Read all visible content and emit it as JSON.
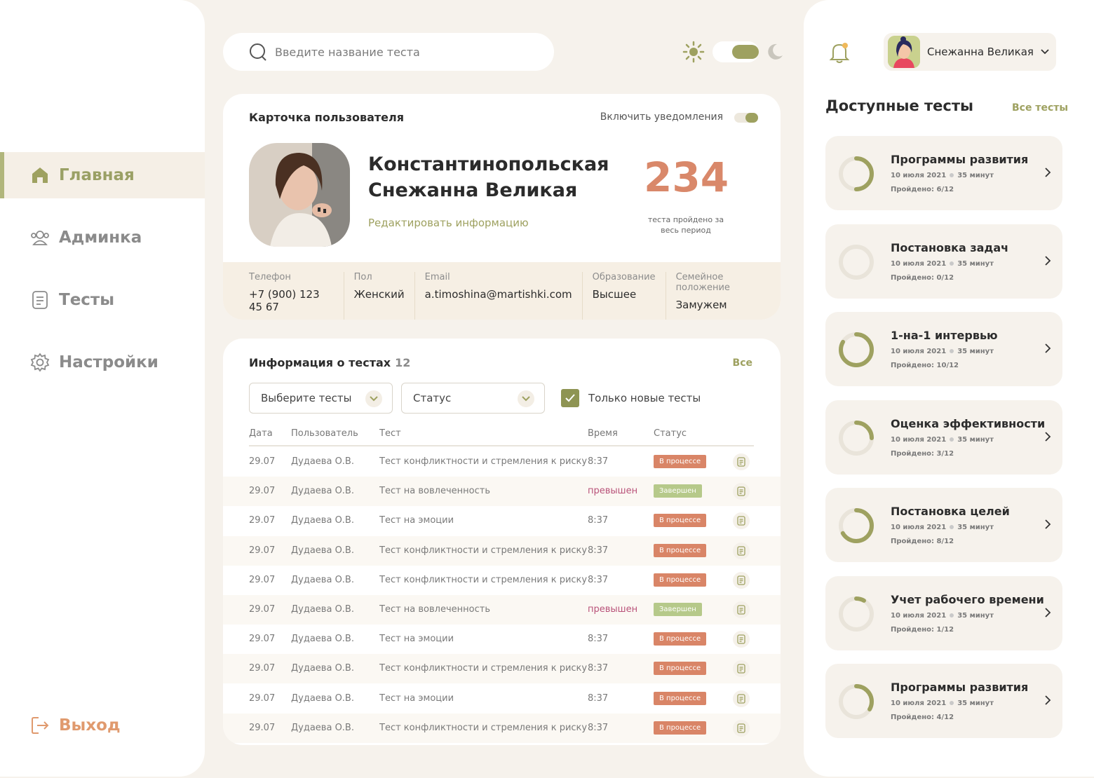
{
  "sidebar": {
    "items": [
      {
        "label": "Главная",
        "icon": "home-icon",
        "active": true
      },
      {
        "label": "Админка",
        "icon": "users-icon",
        "active": false
      },
      {
        "label": "Тесты",
        "icon": "document-icon",
        "active": false
      },
      {
        "label": "Настройки",
        "icon": "gear-icon",
        "active": false
      }
    ],
    "logout": "Выход"
  },
  "search": {
    "placeholder": "Введите название теста"
  },
  "profile": {
    "name": "Снежанна Великая"
  },
  "user_card": {
    "title": "Карточка пользователя",
    "notifications_label": "Включить уведомления",
    "name_line1": "Константинопольская",
    "name_line2": "Снежанна Великая",
    "edit_link": "Редактировать информацию",
    "tests_passed": "234",
    "tests_passed_label_1": "теста пройдено за",
    "tests_passed_label_2": "весь период",
    "info": [
      {
        "label": "Телефон",
        "value": "+7 (900) 123 45 67"
      },
      {
        "label": "Пол",
        "value": "Женский"
      },
      {
        "label": "Email",
        "value": "a.timoshina@martishki.com"
      },
      {
        "label": "Образование",
        "value": "Высшее"
      },
      {
        "label": "Семейное положение",
        "value": "Замужем"
      }
    ]
  },
  "tests_info": {
    "title": "Информация о тестах",
    "count": "12",
    "all_link": "Все",
    "select_tests": "Выберите тесты",
    "select_status": "Статус",
    "only_new_label": "Только новые тесты",
    "columns": [
      "Дата",
      "Пользователь",
      "Тест",
      "Время",
      "Статус"
    ],
    "rows": [
      {
        "date": "29.07",
        "user": "Дудаева О.В.",
        "test": "Тест конфликтности и стремления к риску",
        "time": "8:37",
        "status": "В процессе",
        "kind": "proc",
        "exceeded": false
      },
      {
        "date": "29.07",
        "user": "Дудаева О.В.",
        "test": "Тест на вовлеченность",
        "time": "превышен",
        "status": "Завершен",
        "kind": "done",
        "exceeded": true
      },
      {
        "date": "29.07",
        "user": "Дудаева О.В.",
        "test": "Тест на эмоции",
        "time": "8:37",
        "status": "В процессе",
        "kind": "proc",
        "exceeded": false
      },
      {
        "date": "29.07",
        "user": "Дудаева О.В.",
        "test": "Тест конфликтности и стремления к риску",
        "time": "8:37",
        "status": "В процессе",
        "kind": "proc",
        "exceeded": false
      },
      {
        "date": "29.07",
        "user": "Дудаева О.В.",
        "test": "Тест конфликтности и стремления к риску",
        "time": "8:37",
        "status": "В процессе",
        "kind": "proc",
        "exceeded": false
      },
      {
        "date": "29.07",
        "user": "Дудаева О.В.",
        "test": "Тест на вовлеченность",
        "time": "превышен",
        "status": "Завершен",
        "kind": "done",
        "exceeded": true
      },
      {
        "date": "29.07",
        "user": "Дудаева О.В.",
        "test": "Тест на эмоции",
        "time": "8:37",
        "status": "В процессе",
        "kind": "proc",
        "exceeded": false
      },
      {
        "date": "29.07",
        "user": "Дудаева О.В.",
        "test": "Тест конфликтности и стремления к риску",
        "time": "8:37",
        "status": "В процессе",
        "kind": "proc",
        "exceeded": false
      },
      {
        "date": "29.07",
        "user": "Дудаева О.В.",
        "test": "Тест на эмоции",
        "time": "8:37",
        "status": "В процессе",
        "kind": "proc",
        "exceeded": false
      },
      {
        "date": "29.07",
        "user": "Дудаева О.В.",
        "test": "Тест конфликтности и стремления к риску",
        "time": "8:37",
        "status": "В процессе",
        "kind": "proc",
        "exceeded": false
      }
    ]
  },
  "available_tests": {
    "title": "Доступные тесты",
    "all_link": "Все тесты",
    "items": [
      {
        "name": "Программы развития",
        "date": "10 июля 2021",
        "duration": "35 минут",
        "passed": "Пройдено: 6/12",
        "progress": 0.5
      },
      {
        "name": "Постановка задач",
        "date": "10 июля 2021",
        "duration": "35 минут",
        "passed": "Пройдено: 0/12",
        "progress": 0
      },
      {
        "name": "1-на-1 интервью",
        "date": "10 июля 2021",
        "duration": "35 минут",
        "passed": "Пройдено: 10/12",
        "progress": 0.833
      },
      {
        "name": "Оценка эффективности",
        "date": "10 июля 2021",
        "duration": "35 минут",
        "passed": "Пройдено: 3/12",
        "progress": 0.25
      },
      {
        "name": "Постановка целей",
        "date": "10 июля 2021",
        "duration": "35 минут",
        "passed": "Пройдено: 8/12",
        "progress": 0.667
      },
      {
        "name": "Учет рабочего времени",
        "date": "10 июля 2021",
        "duration": "35 минут",
        "passed": "Пройдено: 1/12",
        "progress": 0.083
      },
      {
        "name": "Программы развития",
        "date": "10 июля 2021",
        "duration": "35 минут",
        "passed": "Пройдено: 4/12",
        "progress": 0.333
      }
    ]
  },
  "colors": {
    "accent": "#9ea160",
    "orange": "#d98567",
    "green": "#b6c98a",
    "bg": "#f6f2ec"
  }
}
